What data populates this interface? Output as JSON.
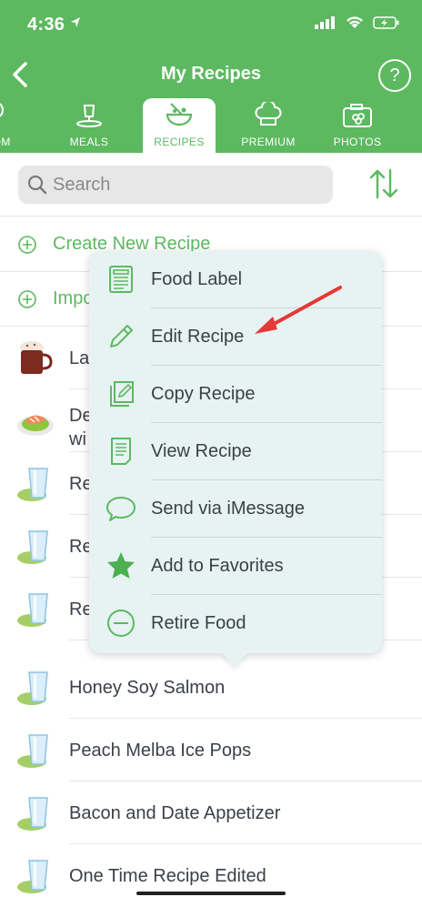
{
  "status_bar": {
    "time": "4:36"
  },
  "nav": {
    "title": "My Recipes",
    "help": "?"
  },
  "tabs": [
    {
      "label": "TOM",
      "icon": "spoon-icon"
    },
    {
      "label": "MEALS",
      "icon": "meal-icon"
    },
    {
      "label": "RECIPES",
      "icon": "recipes-bowl-icon",
      "active": true
    },
    {
      "label": "PREMIUM",
      "icon": "chef-hat-icon"
    },
    {
      "label": "PHOTOS",
      "icon": "camera-food-icon"
    }
  ],
  "search": {
    "placeholder": "Search"
  },
  "actions": {
    "create": "Create New Recipe",
    "import": "Impo"
  },
  "list": [
    {
      "label": "La"
    },
    {
      "label": "De",
      "label2": "wi"
    },
    {
      "label": "Re"
    },
    {
      "label": "Re"
    },
    {
      "label": "Re"
    },
    {
      "label": "Honey Soy Salmon"
    },
    {
      "label": "Peach Melba Ice Pops"
    },
    {
      "label": "Bacon and Date Appetizer"
    },
    {
      "label": "One Time Recipe Edited"
    }
  ],
  "menu": [
    {
      "label": "Food Label",
      "icon": "food-label-icon"
    },
    {
      "label": "Edit Recipe",
      "icon": "pencil-icon"
    },
    {
      "label": "Copy Recipe",
      "icon": "copy-icon"
    },
    {
      "label": "View Recipe",
      "icon": "document-icon"
    },
    {
      "label": "Send via iMessage",
      "icon": "message-bubble-icon"
    },
    {
      "label": "Add to Favorites",
      "icon": "star-icon"
    },
    {
      "label": "Retire Food",
      "icon": "minus-circle-icon"
    }
  ],
  "colors": {
    "brand_green": "#5cb960",
    "menu_bg": "#e7f3f2",
    "annotation_red": "#e53935"
  }
}
